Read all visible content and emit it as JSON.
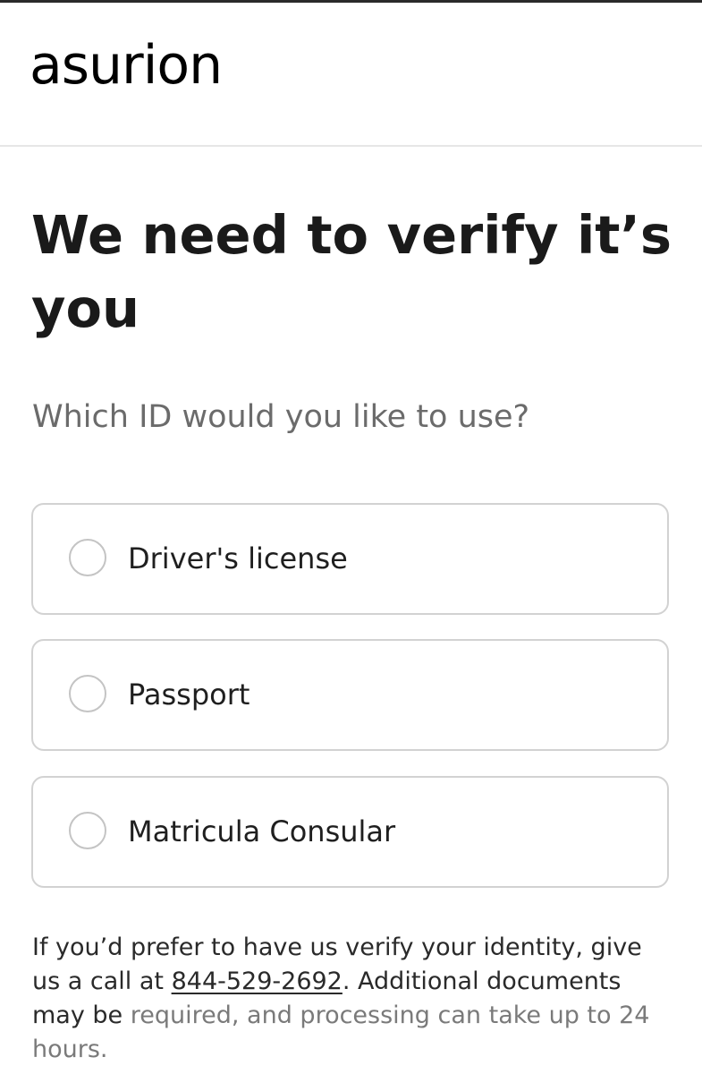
{
  "brand": {
    "logo_text": "asurion"
  },
  "main": {
    "title": "We need to verify it’s you",
    "prompt": "Which ID would you like to use?",
    "options": [
      {
        "label": "Driver's license",
        "selected": false
      },
      {
        "label": "Passport",
        "selected": false
      },
      {
        "label": "Matricula Consular",
        "selected": false
      }
    ]
  },
  "footer": {
    "text_before": "If you’d prefer to have us verify your identity, give us a call at ",
    "phone": "844-529-2692",
    "text_after_dark": ". Additional documents may be",
    "text_after_muted": " required, and processing can take up to 24 hours."
  }
}
